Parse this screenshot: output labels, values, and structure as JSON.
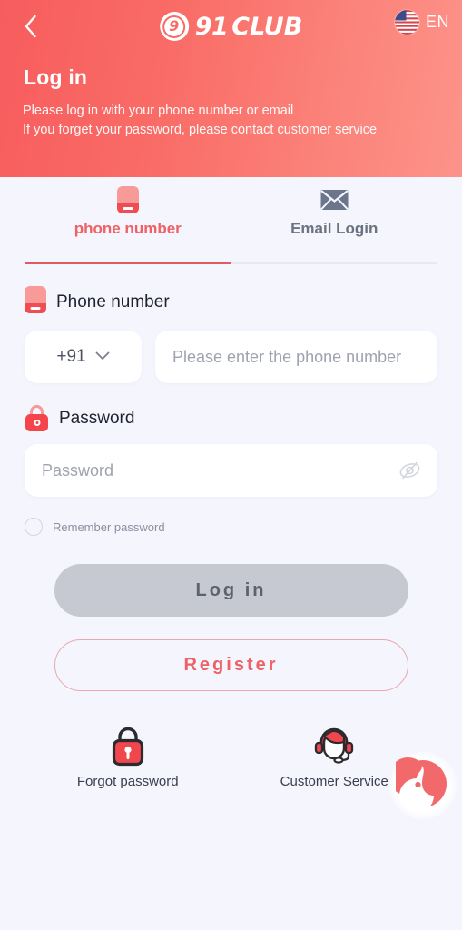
{
  "header": {
    "back_icon": "chevron-left-icon",
    "logo": {
      "badge_glyph": "9",
      "name_number": "91",
      "name_word": "CLUB"
    },
    "language": {
      "flag_icon": "us-flag-icon",
      "label": "EN"
    },
    "title": "Log in",
    "subtitle_line1": "Please log in with your phone number or email",
    "subtitle_line2": "If you forget your password, please contact customer service",
    "gradient_start": "#f75d5e",
    "gradient_end": "#fc938a"
  },
  "tabs": [
    {
      "id": "phone",
      "label": "phone number",
      "icon": "phone-icon",
      "active": true
    },
    {
      "id": "email",
      "label": "Email Login",
      "icon": "envelope-icon",
      "active": false
    }
  ],
  "form": {
    "phone": {
      "label": "Phone number",
      "label_icon": "phone-icon",
      "country_code": "+91",
      "country_code_icon": "chevron-down-icon",
      "placeholder": "Please enter the phone number",
      "value": ""
    },
    "password": {
      "label": "Password",
      "label_icon": "lock-icon",
      "placeholder": "Password",
      "value": "",
      "toggle_icon": "eye-off-icon"
    },
    "remember": {
      "label": "Remember password",
      "checked": false
    }
  },
  "actions": {
    "login_label": "Log in",
    "register_label": "Register"
  },
  "footer": [
    {
      "id": "forgot-password",
      "label": "Forgot password",
      "icon": "lock-key-icon"
    },
    {
      "id": "customer-service",
      "label": "Customer Service",
      "icon": "headset-agent-icon"
    }
  ],
  "chat_widget": {
    "icon": "chat-bubble-face-icon"
  },
  "colors": {
    "accent": "#ee6164",
    "accent_dark": "#f04d52",
    "accent_light": "#f89a98",
    "page_bg": "#f4f5fd",
    "muted_text": "#6c7380",
    "disabled_button": "#c6c8d2"
  }
}
